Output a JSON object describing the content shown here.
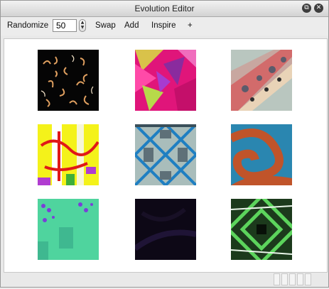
{
  "window": {
    "title": "Evolution Editor",
    "button_1_icon": "restore-icon",
    "button_2_icon": "close-icon"
  },
  "toolbar": {
    "randomize_label": "Randomize",
    "population_value": "50",
    "swap_label": "Swap",
    "add_label": "Add",
    "inspire_label": "Inspire",
    "plus_label": "+"
  },
  "grid": {
    "rows": 3,
    "columns": 3,
    "tiles": [
      "black-with-orange-curls",
      "magenta-pink-shards",
      "ornate-red-gray-band",
      "yellow-red-brush-strokes",
      "teal-gray-lattice",
      "orange-teal-swirl",
      "mint-green-with-purple-spots",
      "dark-purple-noise",
      "green-geometric-rings"
    ]
  }
}
